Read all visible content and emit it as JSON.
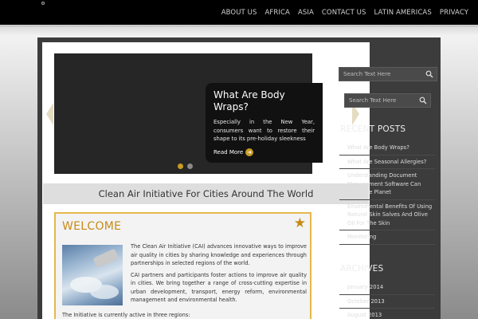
{
  "nav": {
    "items": [
      "ABOUT US",
      "AFRICA",
      "ASIA",
      "CONTACT US",
      "LATIN AMERICAS",
      "PRIVACY"
    ]
  },
  "slider": {
    "title": "What Are Body Wraps?",
    "text": "Especially in the New Year, consumers want to restore their shape to its pre-holiday sleekness",
    "read_more": "Read More"
  },
  "page_heading": "Clean Air Initiative For Cities Around The World",
  "welcome": {
    "title": "WELCOME",
    "paragraph1": "The Clean Air Initiative (CAI) advances innovative ways to improve air quality in cities by sharing knowledge and experiences through partnerships in selected regions of the world.",
    "paragraph2": "CAI partners and participants foster actions to improve air quality in cities. We bring together a range of cross-cutting expertise in urban development, transport, energy reform, environmental management and environmental health.",
    "footer": "The Initiative is currently active in three regions:"
  },
  "sidebar": {
    "search_placeholder_1": "Search Text Here",
    "search_placeholder_2": "Search Text Here",
    "recent_posts_heading": "RECENT POSTS",
    "recent_posts": [
      "What Are Body Wraps?",
      "What Are Seasonal Allergies?",
      "Understanding Document Management Software Can Save The Planet",
      "Enviromental Benefits Of Using Natural Skin Salves And Olive Oil For The Skin",
      "Monitoring"
    ],
    "archives_heading": "ARCHIVES",
    "archives": [
      "January 2014",
      "October 2013",
      "August 2013"
    ]
  },
  "colors": {
    "accent_gold": "#c88a16",
    "topbar": "#000000",
    "sidebar_bg": "#3c3c3c"
  }
}
